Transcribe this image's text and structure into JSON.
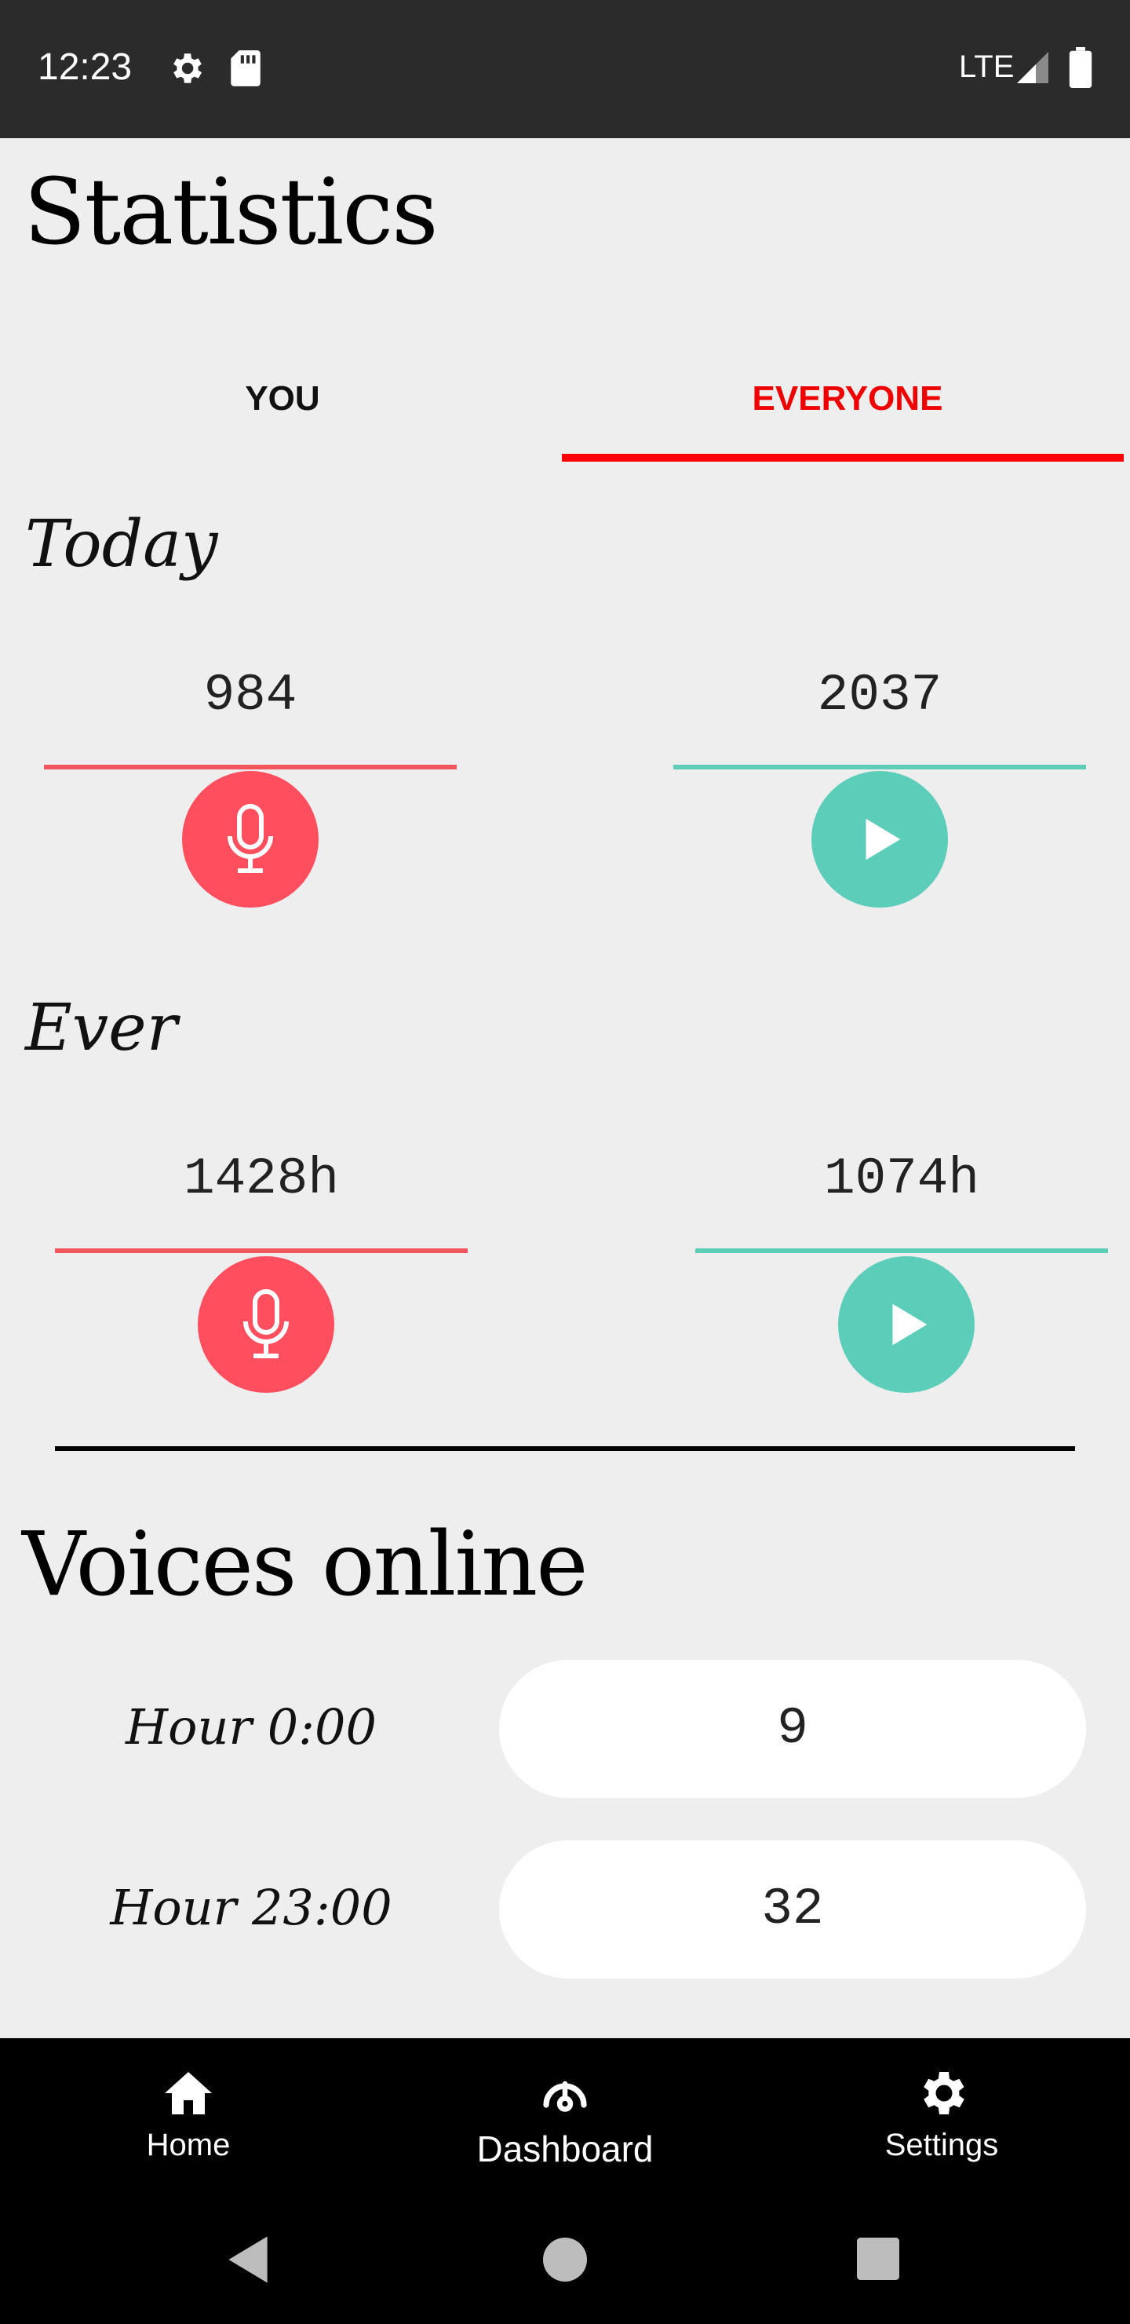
{
  "status_bar": {
    "time": "12:23",
    "network": "LTE"
  },
  "header": {
    "title": "Statistics"
  },
  "tabs": [
    {
      "label": "YOU",
      "selected": false
    },
    {
      "label": "EVERYONE",
      "selected": true
    }
  ],
  "today": {
    "label": "Today",
    "recorded": "984",
    "listened": "2037"
  },
  "ever": {
    "label": "Ever",
    "recorded": "1428h",
    "listened": "1074h"
  },
  "voices_online": {
    "title": "Voices online",
    "rows": [
      {
        "label": "Hour 0:00",
        "value": "9"
      },
      {
        "label": "Hour 23:00",
        "value": "32"
      }
    ]
  },
  "bottom_nav": {
    "items": [
      {
        "label": "Home",
        "icon": "home-icon"
      },
      {
        "label": "Dashboard",
        "icon": "dashboard-icon",
        "selected": true
      },
      {
        "label": "Settings",
        "icon": "gear-icon"
      }
    ]
  },
  "colors": {
    "accent_red": "#ff0000",
    "record_red": "#ff4f5e",
    "listen_teal": "#5ccdb8"
  }
}
